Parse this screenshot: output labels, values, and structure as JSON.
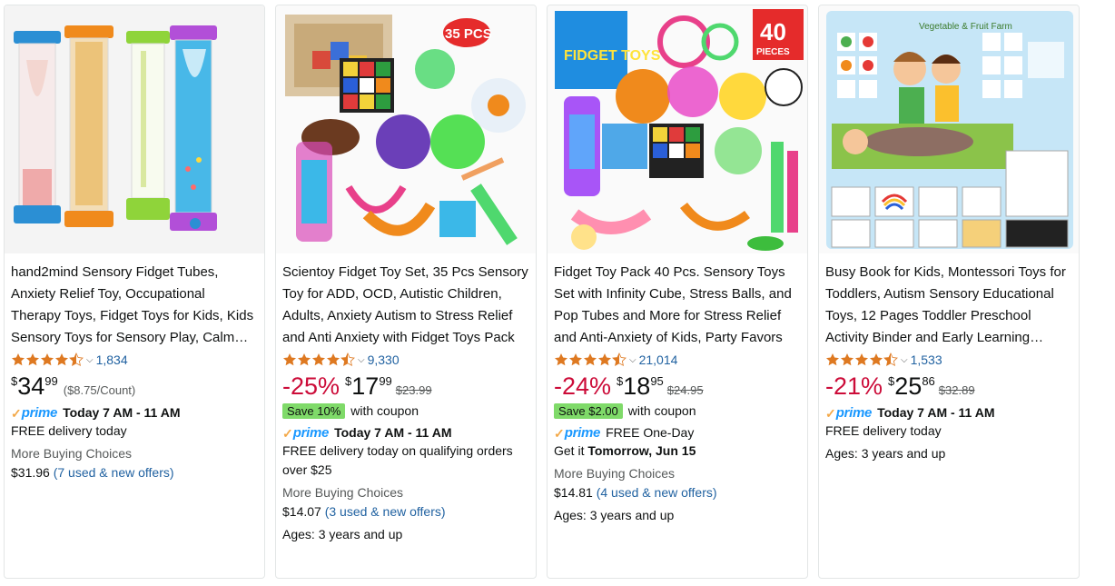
{
  "colors": {
    "star": "#de7921",
    "link": "#2162a1",
    "discount": "#cc0c39",
    "coupon_badge": "#7fda69",
    "prime_blue": "#1a98ff",
    "prime_check": "#f3a847"
  },
  "products": [
    {
      "title": "hand2mind Sensory Fidget Tubes, Anxiety Relief Toy, Occupational Therapy Toys, Fidget Toys for Kids, Kids Sensory Toys for Sensory Play, Calm Down Corner Supplies",
      "rating": 4.5,
      "review_count": "1,834",
      "discount": "",
      "price_symbol": "$",
      "price_whole": "34",
      "price_fraction": "99",
      "unit_price": "($8.75/Count)",
      "list_price": "",
      "coupon": "",
      "coupon_suffix": "",
      "prime_label": "prime",
      "delivery_main": "Today 7 AM - 11 AM",
      "delivery_line": "FREE delivery today",
      "delivery_line2": "",
      "buying_choices_label": "More Buying Choices",
      "buying_choices_price": "$31.96",
      "buying_choices_offers": "(7 used & new offers)",
      "ages": ""
    },
    {
      "title": "Scientoy Fidget Toy Set, 35 Pcs Sensory Toy for ADD, OCD, Autistic Children, Adults, Anxiety Autism to Stress Relief and Anti Anxiety with Fidget Toys Pack",
      "rating": 4.5,
      "review_count": "9,330",
      "discount": "-25%",
      "price_symbol": "$",
      "price_whole": "17",
      "price_fraction": "99",
      "unit_price": "",
      "list_price": "$23.99",
      "coupon": "Save 10%",
      "coupon_suffix": "with coupon",
      "prime_label": "prime",
      "delivery_main": "Today 7 AM - 11 AM",
      "delivery_line": "FREE delivery today on qualifying orders over $25",
      "delivery_line2": "",
      "buying_choices_label": "More Buying Choices",
      "buying_choices_price": "$14.07",
      "buying_choices_offers": "(3 used & new offers)",
      "ages": "Ages: 3 years and up"
    },
    {
      "title": "Fidget Toy Pack 40 Pcs. Sensory Toys Set with Infinity Cube, Stress Balls, and Pop Tubes and More for Stress Relief and Anti-Anxiety of Kids, Party Favors",
      "rating": 4.5,
      "review_count": "21,014",
      "discount": "-24%",
      "price_symbol": "$",
      "price_whole": "18",
      "price_fraction": "95",
      "unit_price": "",
      "list_price": "$24.95",
      "coupon": "Save $2.00",
      "coupon_suffix": "with coupon",
      "prime_label": "prime",
      "delivery_main": "FREE One-Day",
      "delivery_line": "Get it ",
      "delivery_line2": "Tomorrow, Jun 15",
      "buying_choices_label": "More Buying Choices",
      "buying_choices_price": "$14.81",
      "buying_choices_offers": "(4 used & new offers)",
      "ages": "Ages: 3 years and up"
    },
    {
      "title": "Busy Book for Kids, Montessori Toys for Toddlers, Autism Sensory Educational Toys, 12 Pages Toddler Preschool Activity Binder and Early Learning Workbook",
      "rating": 4.5,
      "review_count": "1,533",
      "discount": "-21%",
      "price_symbol": "$",
      "price_whole": "25",
      "price_fraction": "86",
      "unit_price": "",
      "list_price": "$32.89",
      "coupon": "",
      "coupon_suffix": "",
      "prime_label": "prime",
      "delivery_main": "Today 7 AM - 11 AM",
      "delivery_line": "FREE delivery today",
      "delivery_line2": "",
      "buying_choices_label": "",
      "buying_choices_price": "",
      "buying_choices_offers": "",
      "ages": "Ages: 3 years and up"
    }
  ],
  "images": [
    {
      "badge": ""
    },
    {
      "badge": "35 PCS"
    },
    {
      "badge": "40",
      "badge_sub": "PIECES",
      "brand": "FIDGET TOYS"
    },
    {
      "badge": "",
      "cover_title": "Vegetable & Fruit Farm"
    }
  ]
}
